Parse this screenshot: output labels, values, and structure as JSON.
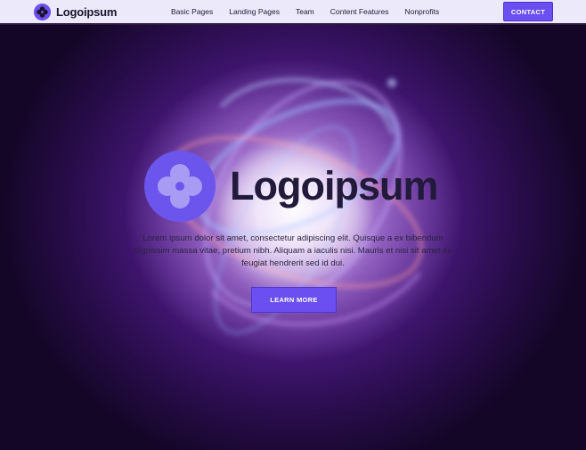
{
  "navbar": {
    "brand": "Logoipsum",
    "links": [
      "Basic Pages",
      "Landing Pages",
      "Team",
      "Content Features",
      "Nonprofits"
    ],
    "contact_label": "CONTACT"
  },
  "hero": {
    "title": "Logoipsum",
    "description": "Lorem ipsum dolor sit amet, consectetur adipiscing elit. Quisque a ex bibendum dignissim massa vitae, pretium nibh. Aliquam a iaculis nisi. Mauris et nisi sit amet ex feugiat hendrerit sed id dui.",
    "cta_label": "LEARN MORE"
  },
  "colors": {
    "accent": "#6b4ff0",
    "nav_background": "#ece9fb",
    "hero_dark": "#1a0b2e",
    "text_dark": "#221a3a"
  },
  "icons": {
    "brand_mark": "four-petal-logo-icon"
  }
}
